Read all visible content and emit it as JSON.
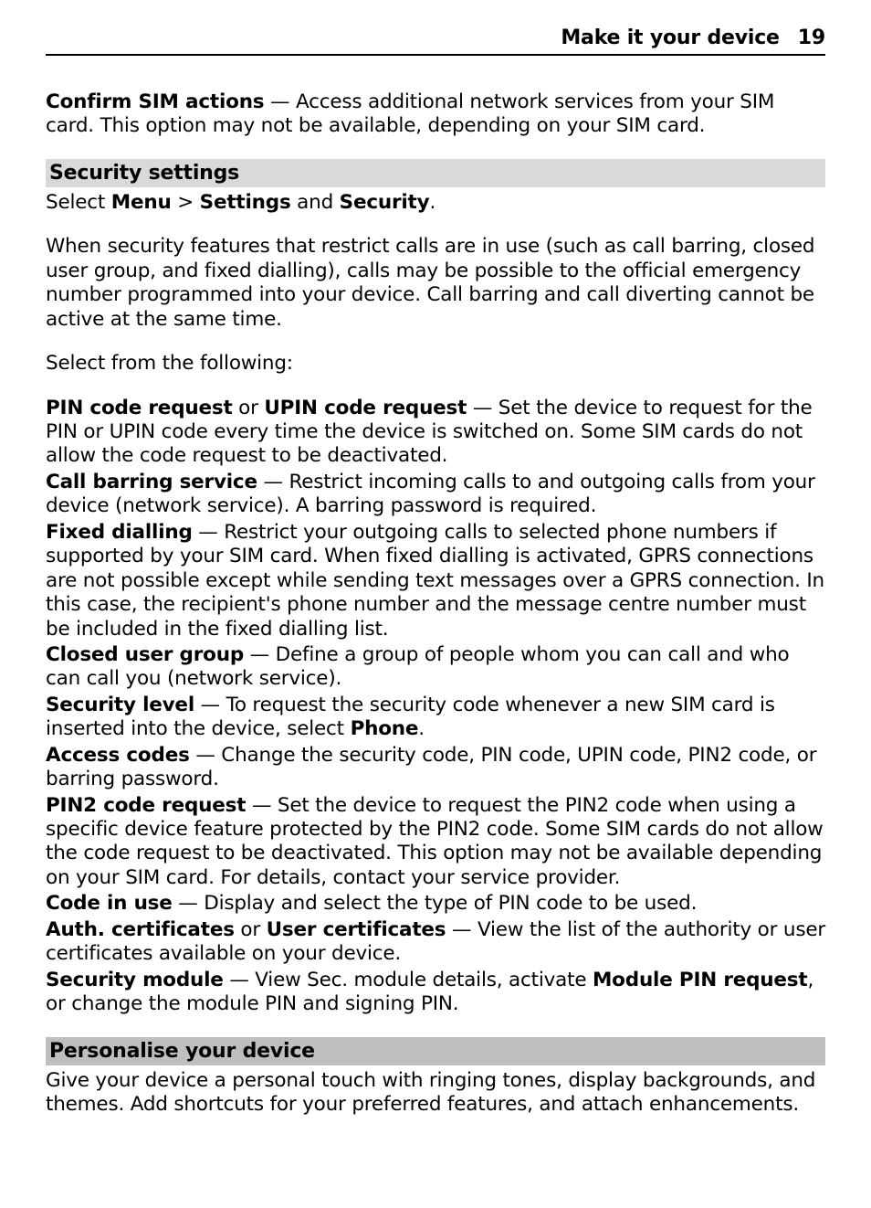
{
  "header": {
    "title": "Make it your device",
    "page": "19"
  },
  "intro": {
    "term": "Confirm SIM actions",
    "desc": " — Access additional network services from your SIM card. This option may not be available, depending on your SIM card."
  },
  "security": {
    "heading": "Security settings",
    "nav_prefix": "Select ",
    "menu": "Menu",
    "gt": " > ",
    "settings": "Settings",
    "and": " and ",
    "security_word": "Security",
    "nav_suffix": ".",
    "warn": "When security features that restrict calls are in use (such as call barring, closed user group, and fixed dialling), calls may be possible to the official emergency number programmed into your device. Call barring and call diverting cannot be active at the same time.",
    "select_from": "Select from the following:"
  },
  "items": {
    "pin_term1": "PIN code request",
    "pin_or": " or ",
    "pin_term2": "UPIN code request",
    "pin_desc": " — Set the device to request for the PIN or UPIN code every time the device is switched on. Some SIM cards do not allow the code request to be deactivated.",
    "callbar_term": "Call barring service",
    "callbar_desc": " — Restrict incoming calls to and outgoing calls from your device (network service). A barring password is required.",
    "fixed_term": "Fixed dialling",
    "fixed_desc": " — Restrict your outgoing calls to selected phone numbers if supported by your SIM card. When fixed dialling is activated, GPRS connections are not possible except while sending text messages over a GPRS connection. In this case, the recipient's phone number and the message centre number must be included in the fixed dialling list.",
    "cug_term": "Closed user group",
    "cug_desc": " — Define a group of people whom you can call and who can call you (network service).",
    "seclevel_term": "Security level",
    "seclevel_desc1": " — To request the security code whenever a new SIM card is inserted into the device, select ",
    "seclevel_phone": "Phone",
    "seclevel_desc2": ".",
    "access_term": "Access codes",
    "access_desc": " — Change the security code, PIN code, UPIN code, PIN2 code, or barring password.",
    "pin2_term": "PIN2 code request",
    "pin2_desc": " — Set the device to request the PIN2 code when using a specific device feature protected by the PIN2 code. Some SIM cards do not allow the code request to be deactivated. This option may not be available depending on your SIM card. For details, contact your service provider.",
    "codeuse_term": "Code in use",
    "codeuse_desc": " — Display and select the type of PIN code to be used.",
    "auth_term1": "Auth. certificates",
    "auth_or": " or ",
    "auth_term2": "User certificates",
    "auth_desc": " — View the list of the authority or user certificates available on your device.",
    "secmod_term": "Security module",
    "secmod_desc1": " — View Sec. module details, activate ",
    "secmod_mpr": "Module PIN request",
    "secmod_desc2": ", or change the module PIN and signing PIN."
  },
  "personalise": {
    "heading": "Personalise your device",
    "body": "Give your device a personal touch with ringing tones, display backgrounds, and themes. Add shortcuts for your preferred features, and attach enhancements."
  }
}
